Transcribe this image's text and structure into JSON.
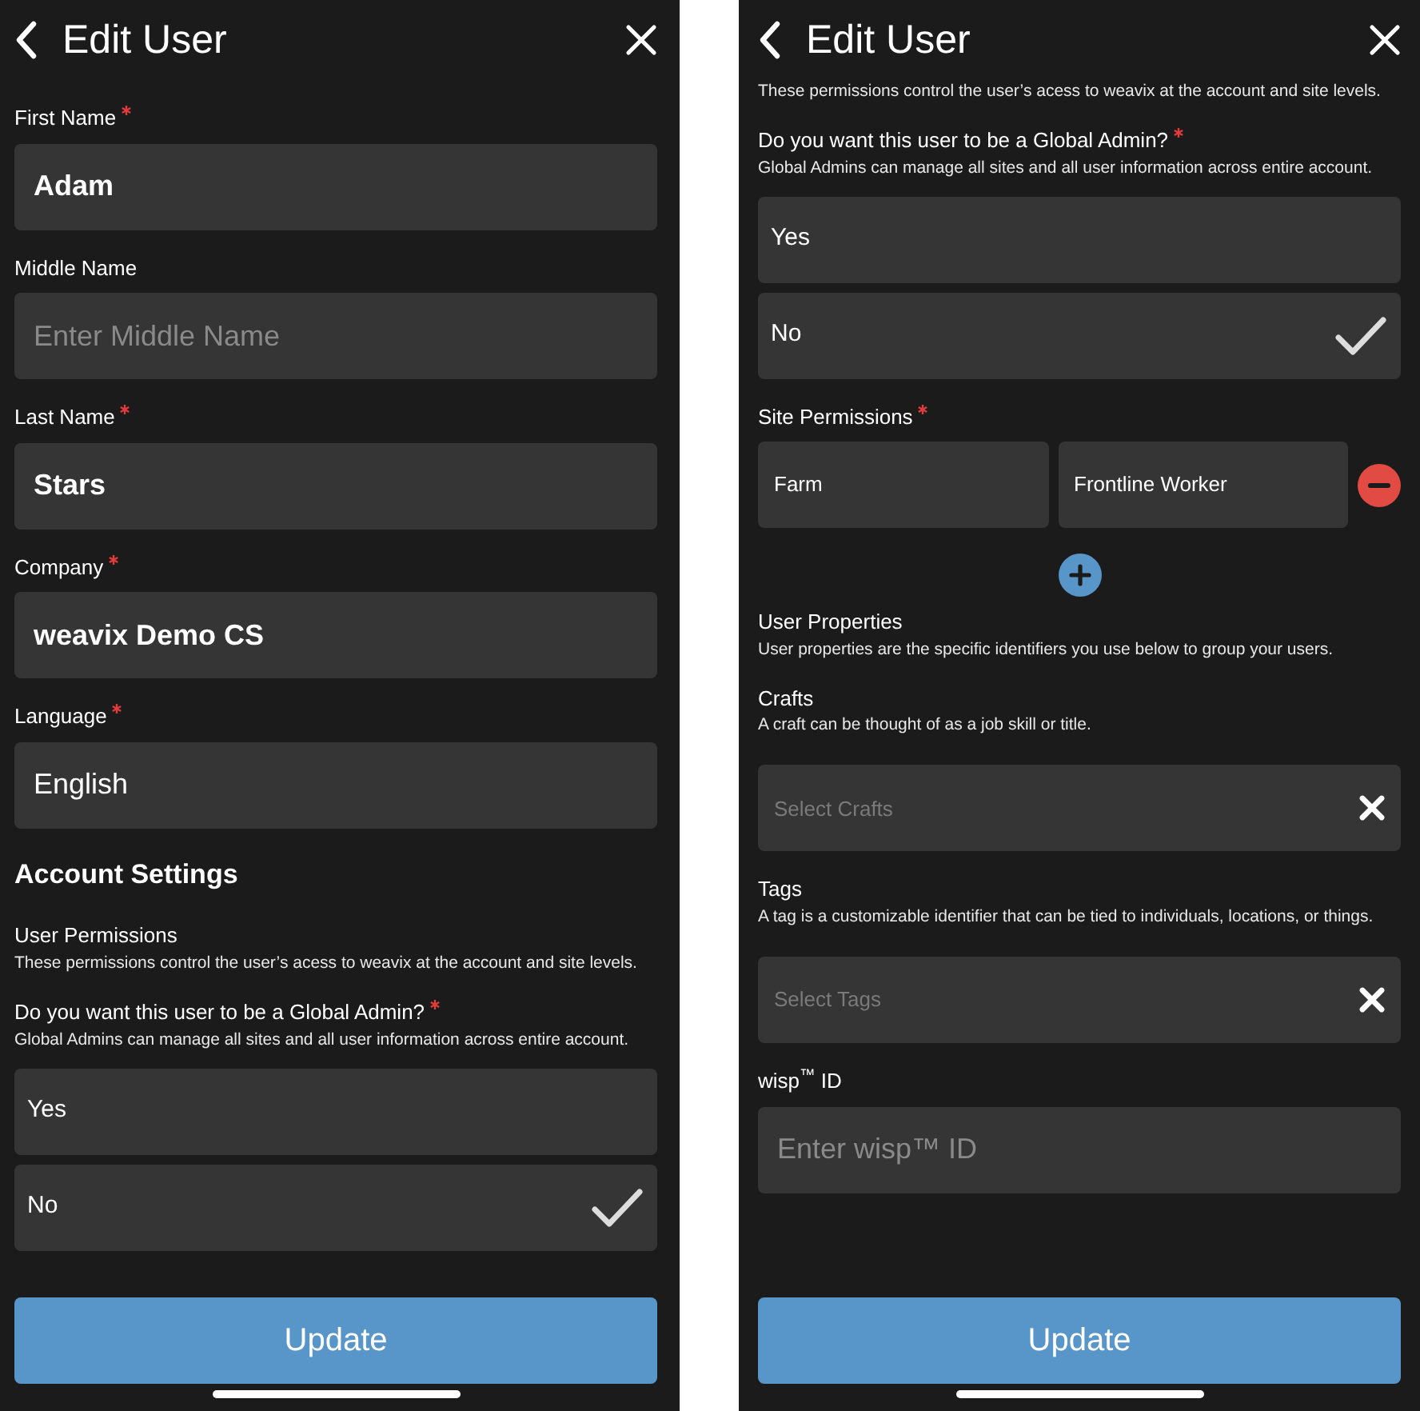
{
  "screens": [
    {
      "title": "Edit User",
      "items": [
        {
          "kind": "field",
          "label": "First Name",
          "required": true,
          "value": "Adam",
          "bold": true
        },
        {
          "kind": "field",
          "label": "Middle Name",
          "required": false,
          "placeholder": "Enter Middle Name"
        },
        {
          "kind": "field",
          "label": "Last Name",
          "required": true,
          "value": "Stars",
          "bold": true
        },
        {
          "kind": "field",
          "label": "Company",
          "required": true,
          "value": "weavix Demo CS",
          "bold": true
        },
        {
          "kind": "field",
          "label": "Language",
          "required": true,
          "value": "English",
          "bold": false
        },
        {
          "kind": "section",
          "text": "Account Settings"
        },
        {
          "kind": "label",
          "text": "User Permissions",
          "required": false
        },
        {
          "kind": "note",
          "text": "These permissions control the user’s acess to weavix at the account and site levels."
        },
        {
          "kind": "label",
          "text": "Do you want this user to be a Global Admin?",
          "required": true
        },
        {
          "kind": "note",
          "text": "Global Admins can manage all sites and all user information across entire account."
        },
        {
          "kind": "option",
          "label": "Yes",
          "selected": false
        },
        {
          "kind": "option",
          "label": "No",
          "selected": true
        },
        {
          "kind": "button",
          "label": "Update"
        }
      ]
    },
    {
      "title": "Edit User",
      "items": [
        {
          "kind": "note",
          "text": "These permissions control the user’s acess to weavix at the account and site levels."
        },
        {
          "kind": "label",
          "text": "Do you want this user to be a Global Admin?",
          "required": true
        },
        {
          "kind": "note",
          "text": "Global Admins can manage all sites and all user information across entire account."
        },
        {
          "kind": "option",
          "label": "Yes",
          "selected": false
        },
        {
          "kind": "option",
          "label": "No",
          "selected": true
        },
        {
          "kind": "label",
          "text": "Site Permissions",
          "required": true
        },
        {
          "kind": "site_row",
          "site": "Farm",
          "role": "Frontline Worker"
        },
        {
          "kind": "add"
        },
        {
          "kind": "label",
          "text": "User Properties",
          "required": false
        },
        {
          "kind": "note",
          "text": "User properties are the specific identifiers you use below to group your users."
        },
        {
          "kind": "label",
          "text": "Crafts",
          "required": false
        },
        {
          "kind": "note",
          "text": "A craft can be thought of as a job skill or title."
        },
        {
          "kind": "select",
          "placeholder": "Select Crafts"
        },
        {
          "kind": "label",
          "text": "Tags",
          "required": false
        },
        {
          "kind": "note",
          "text": "A tag is a customizable identifier that can be tied to individuals, locations, or things."
        },
        {
          "kind": "select",
          "placeholder": "Select Tags"
        },
        {
          "kind": "field",
          "label": "wisp$^{™}$ ID",
          "required": false,
          "placeholder": "Enter wisp™ ID"
        },
        {
          "kind": "button",
          "label": "Update"
        }
      ]
    }
  ]
}
